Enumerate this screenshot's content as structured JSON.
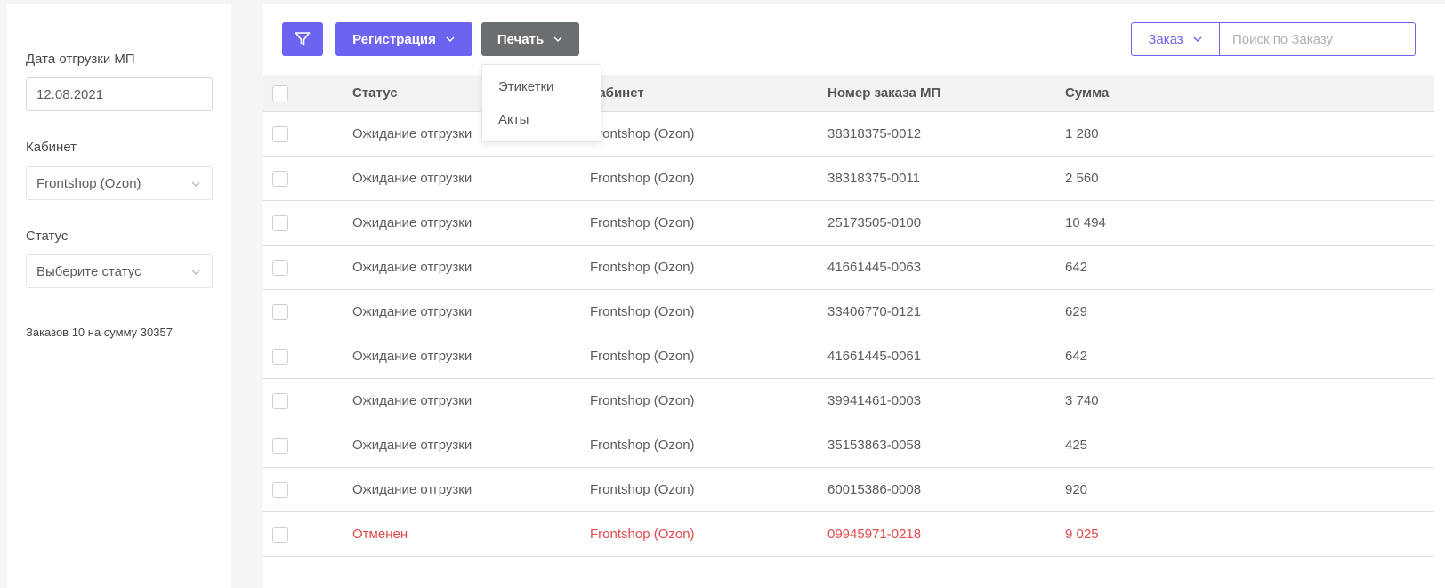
{
  "filters": {
    "ship_date": {
      "label": "Дата отгрузки МП",
      "value": "12.08.2021"
    },
    "cabinet": {
      "label": "Кабинет",
      "value": "Frontshop (Ozon)"
    },
    "status": {
      "label": "Статус",
      "placeholder": "Выберите статус"
    },
    "summary": "Заказов 10 на сумму 30357"
  },
  "toolbar": {
    "filter_icon": "filter-icon",
    "register_label": "Регистрация",
    "print_label": "Печать"
  },
  "search": {
    "type_label": "Заказ",
    "placeholder": "Поиск по Заказу"
  },
  "print_menu": {
    "items": [
      "Этикетки",
      "Акты"
    ]
  },
  "table": {
    "columns": [
      "Статус",
      "Кабинет",
      "Номер заказа МП",
      "Сумма"
    ],
    "rows": [
      {
        "status": "Ожидание отгрузки",
        "cabinet": "Frontshop (Ozon)",
        "number": "38318375-0012",
        "sum": "1 280"
      },
      {
        "status": "Ожидание отгрузки",
        "cabinet": "Frontshop (Ozon)",
        "number": "38318375-0011",
        "sum": "2 560"
      },
      {
        "status": "Ожидание отгрузки",
        "cabinet": "Frontshop (Ozon)",
        "number": "25173505-0100",
        "sum": "10 494"
      },
      {
        "status": "Ожидание отгрузки",
        "cabinet": "Frontshop (Ozon)",
        "number": "41661445-0063",
        "sum": "642"
      },
      {
        "status": "Ожидание отгрузки",
        "cabinet": "Frontshop (Ozon)",
        "number": "33406770-0121",
        "sum": "629"
      },
      {
        "status": "Ожидание отгрузки",
        "cabinet": "Frontshop (Ozon)",
        "number": "41661445-0061",
        "sum": "642"
      },
      {
        "status": "Ожидание отгрузки",
        "cabinet": "Frontshop (Ozon)",
        "number": "39941461-0003",
        "sum": "3 740"
      },
      {
        "status": "Ожидание отгрузки",
        "cabinet": "Frontshop (Ozon)",
        "number": "35153863-0058",
        "sum": "425"
      },
      {
        "status": "Ожидание отгрузки",
        "cabinet": "Frontshop (Ozon)",
        "number": "60015386-0008",
        "sum": "920"
      },
      {
        "status": "Отменен",
        "cabinet": "Frontshop (Ozon)",
        "number": "09945971-0218",
        "sum": "9 025"
      }
    ]
  },
  "colors": {
    "accent": "#6c63f0",
    "print_button": "#6b6e71",
    "cancelled": "#e24a4a"
  }
}
